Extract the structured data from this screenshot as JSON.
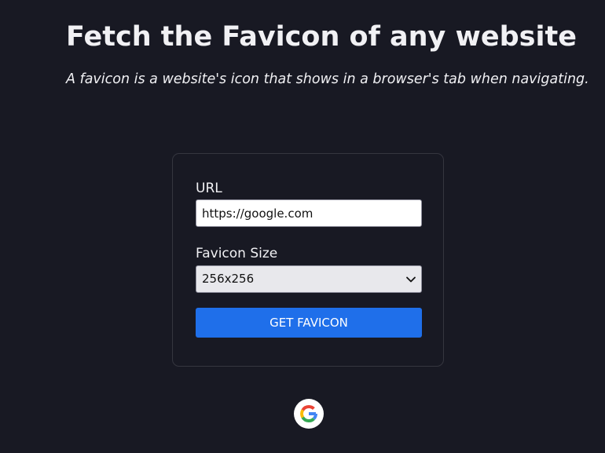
{
  "header": {
    "title": "Fetch the Favicon of any website",
    "subtitle": "A favicon is a website's icon that shows in a browser's tab when navigating."
  },
  "form": {
    "url_label": "URL",
    "url_value": "https://google.com",
    "size_label": "Favicon Size",
    "size_selected": "256x256",
    "submit_label": "GET FAVICON"
  },
  "result": {
    "favicon_icon": "google-g-logo-icon"
  },
  "colors": {
    "background": "#181923",
    "button": "#1f6fea",
    "card_border": "#35363f"
  }
}
